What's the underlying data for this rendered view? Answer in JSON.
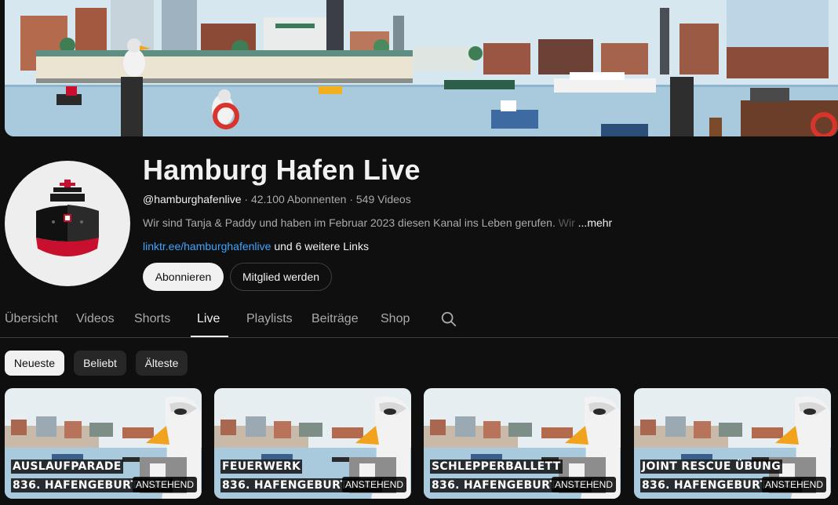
{
  "channel": {
    "title": "Hamburg Hafen Live",
    "handle": "@hamburghafenlive",
    "subscribers": "42.100 Abonnenten",
    "videos": "549 Videos",
    "description": "Wir sind Tanja & Paddy und haben im Februar 2023 diesen Kanal ins Leben gerufen.",
    "description_fade": "Wir",
    "more_label": "...mehr",
    "link": "linktr.ee/hamburghafenlive",
    "links_suffix": "und 6 weitere Links",
    "subscribe_label": "Abonnieren",
    "member_label": "Mitglied werden"
  },
  "tabs": [
    {
      "label": "Übersicht"
    },
    {
      "label": "Videos"
    },
    {
      "label": "Shorts"
    },
    {
      "label": "Live"
    },
    {
      "label": "Playlists"
    },
    {
      "label": "Beiträge"
    },
    {
      "label": "Shop"
    }
  ],
  "active_tab": "Live",
  "chips": [
    {
      "label": "Neueste"
    },
    {
      "label": "Beliebt"
    },
    {
      "label": "Älteste"
    }
  ],
  "videos": [
    {
      "line1": "AUSLAUFPARADE",
      "line2": "836. HAFENGEBURTSTAG",
      "badge": "ANSTEHEND"
    },
    {
      "line1": "FEUERWERK",
      "line2": "836. HAFENGEBURTSTAG",
      "badge": "ANSTEHEND"
    },
    {
      "line1": "SCHLEPPERBALLETT",
      "line2": "836. HAFENGEBURTSTAG",
      "badge": "ANSTEHEND"
    },
    {
      "line1": "JOINT RESCUE ÜBUNG",
      "line2": "836. HAFENGEBURTSTAG",
      "badge": "ANSTEHEND"
    }
  ],
  "colors": {
    "background": "#0f0f0f",
    "link": "#3ea6ff",
    "sky": "#cfe3ee",
    "water": "#a9c9dd",
    "ship_red": "#c8102e"
  },
  "icons": [
    "search-icon",
    "ship-logo-icon"
  ]
}
